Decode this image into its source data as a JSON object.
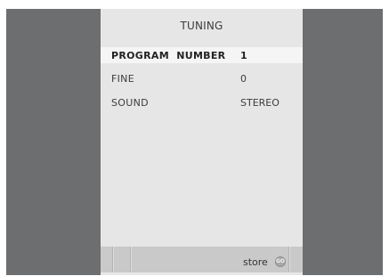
{
  "menu": {
    "title": "TUNING",
    "rows": [
      {
        "label": "PROGRAM  NUMBER",
        "value": "1",
        "selected": true
      },
      {
        "label": "FINE",
        "value": "0",
        "selected": false
      },
      {
        "label": "SOUND",
        "value": "STEREO",
        "selected": false
      }
    ]
  },
  "footer": {
    "store_label": "store",
    "go_icon_text": "GO",
    "go_icon": "go-button-icon"
  },
  "colors": {
    "screen_background": "#6d6e70",
    "panel_background": "#e6e6e6",
    "highlight": "#f5f5f5",
    "bottom_bar": "#c9c9c9"
  }
}
